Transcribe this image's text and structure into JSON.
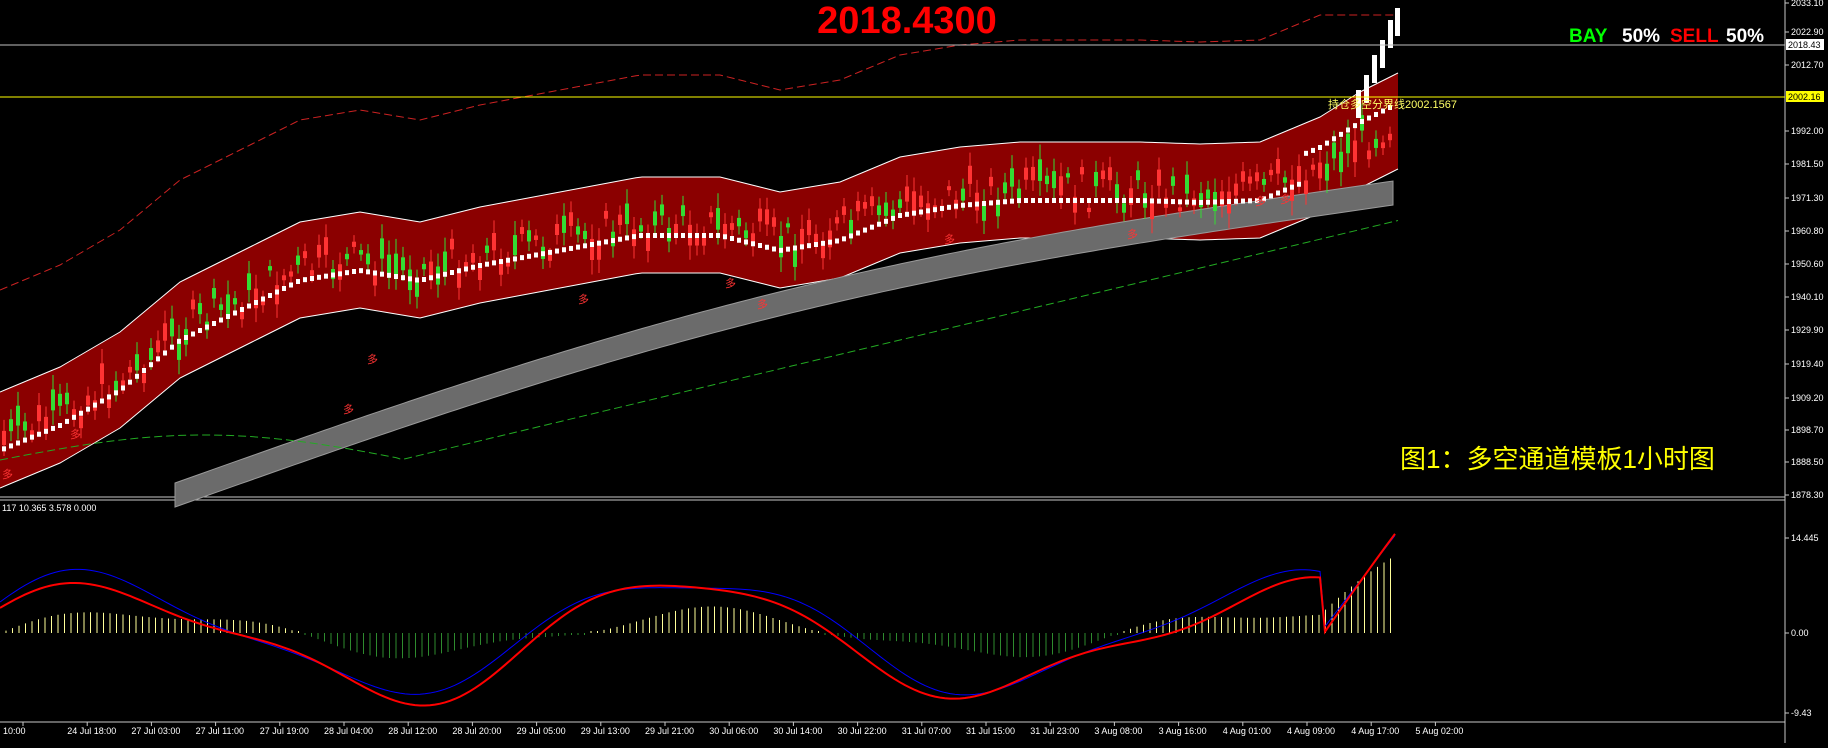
{
  "header": {
    "price_display": "2018.4300",
    "bay_label": "BAY",
    "bay_pct": "50%",
    "sell_label": "SELL",
    "sell_pct": "50%"
  },
  "main_panel": {
    "current_price_tag": "2018.43",
    "divider_price_tag": "2002.16",
    "divider_label": "持仓多空分界线2002.1567",
    "caption": "图1：多空通道模板1小时图",
    "signal_label": "多",
    "price_axis_labels": [
      "2033.10",
      "2022.90",
      "2018.43",
      "2012.70",
      "2002.16",
      "1992.00",
      "1981.50",
      "1971.30",
      "1960.80",
      "1950.60",
      "1940.10",
      "1929.90",
      "1919.40",
      "1909.20",
      "1898.70",
      "1888.50",
      "1878.30"
    ]
  },
  "indicator_panel": {
    "header_text": "117 10.365 3.578 0.000",
    "axis_labels": [
      "14.445",
      "0.00",
      "-9.43"
    ]
  },
  "time_axis": {
    "labels": [
      "10:00",
      "24 Jul 18:00",
      "27 Jul 03:00",
      "27 Jul 11:00",
      "27 Jul 19:00",
      "28 Jul 04:00",
      "28 Jul 12:00",
      "28 Jul 20:00",
      "29 Jul 05:00",
      "29 Jul 13:00",
      "29 Jul 21:00",
      "30 Jul 06:00",
      "30 Jul 14:00",
      "30 Jul 22:00",
      "31 Jul 07:00",
      "31 Jul 15:00",
      "31 Jul 23:00",
      "3 Aug 08:00",
      "3 Aug 16:00",
      "4 Aug 01:00",
      "4 Aug 09:00",
      "4 Aug 17:00",
      "5 Aug 02:00"
    ]
  },
  "colors": {
    "background": "#000000",
    "price_red": "#ff0000",
    "bay_green": "#00ff00",
    "channel_fill": "#8b0000",
    "caption_yellow": "#ffff00",
    "macd_main": "#0000ff",
    "macd_signal": "#ff0000",
    "hist_pos": "#ffff99",
    "hist_neg": "#2e8b2e"
  }
}
